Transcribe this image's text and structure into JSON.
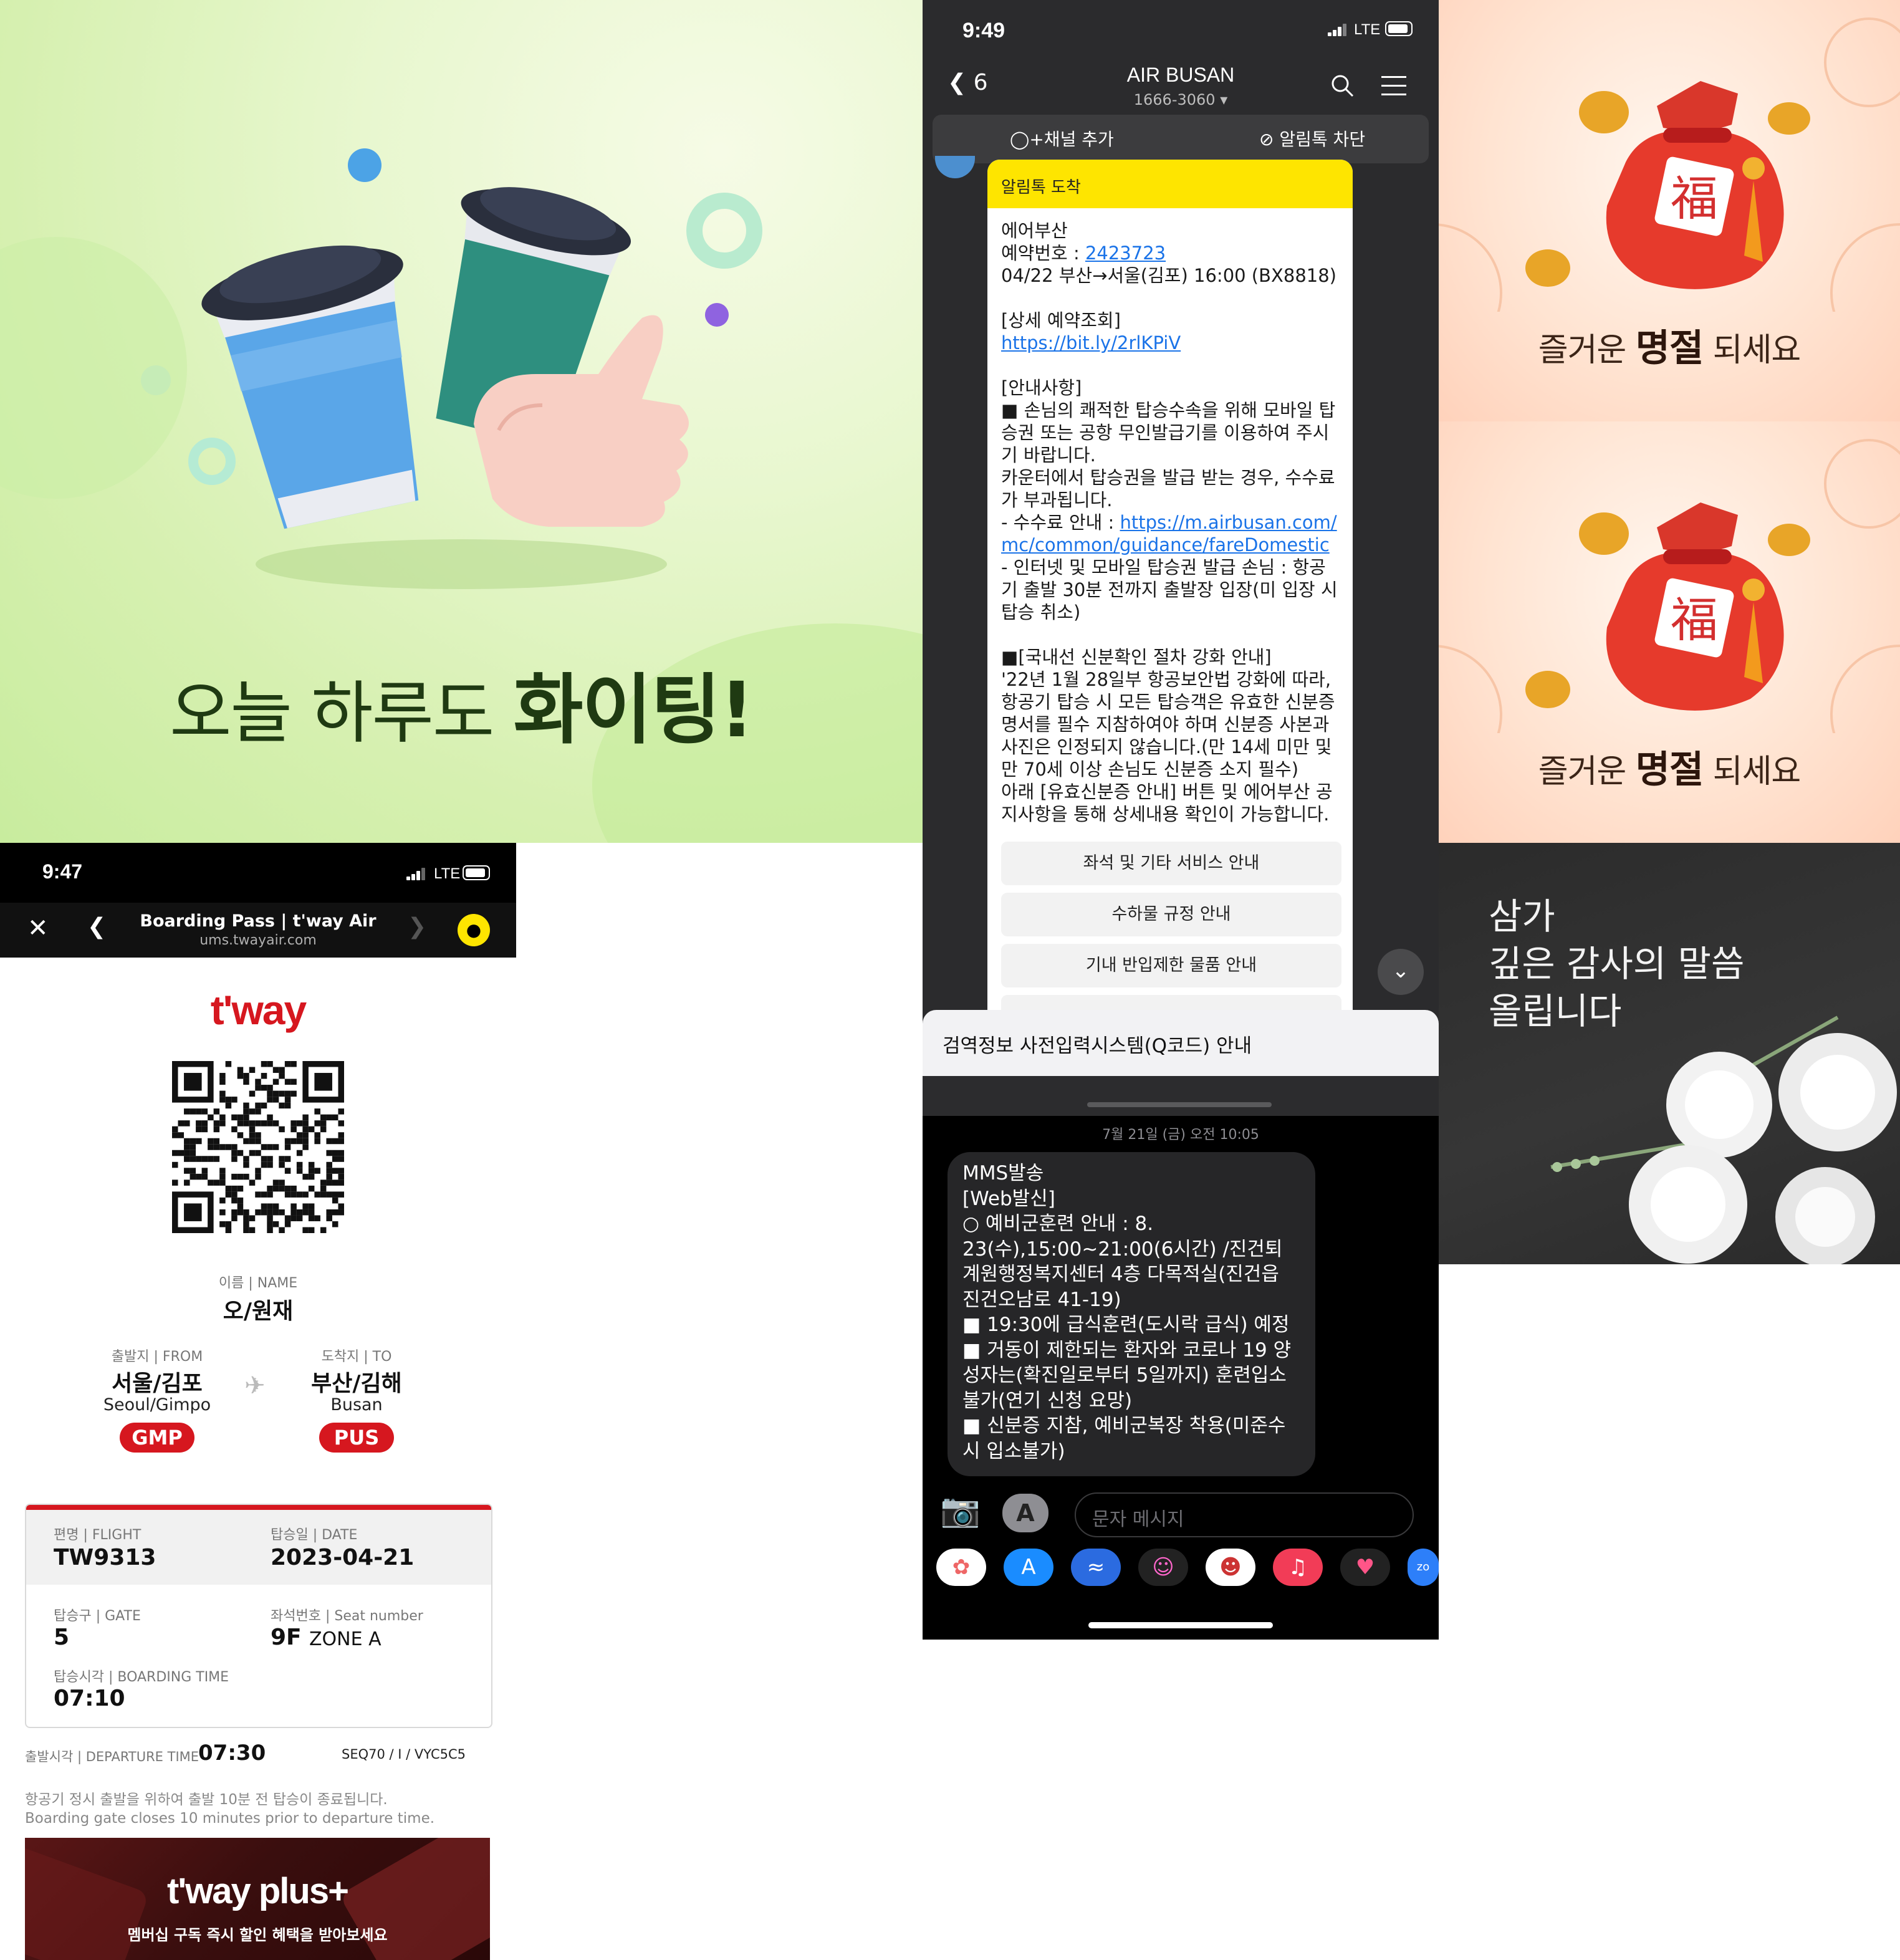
{
  "cheer": {
    "title_pre": "오늘 하루도 ",
    "title_bold": "화이팅!"
  },
  "chat": {
    "status_time": "9:49",
    "status_net": "LTE",
    "back_count": "6",
    "title": "AIR BUSAN",
    "phone": "1666-3060 ▾",
    "add_channel": "+채널 추가",
    "block": "알림톡 차단",
    "bubble_header": "알림톡 도착",
    "body_line1": "에어부산",
    "reservation_label": "예약번호 : ",
    "reservation_no": "2423723",
    "flight_line": "04/22 부산→서울(김포) 16:00 (BX8818)",
    "detail_heading": "[상세 예약조회]",
    "detail_link": "https://bit.ly/2rlKPiV",
    "notice_heading": "[안내사항]",
    "notice_1": "■ 손님의 쾌적한 탑승수속을 위해 모바일 탑승권 또는 공항 무인발급기를 이용하여 주시기 바랍니다.",
    "notice_2": "카운터에서 탑승권을 발급 받는 경우, 수수료가 부과됩니다.",
    "notice_3_label": "- 수수료 안내 : ",
    "notice_3_link": "https://m.airbusan.com/mc/common/guidance/fareDomestic",
    "notice_4": "- 인터넷 및 모바일 탑승권 발급 손님 : 항공기 출발 30분 전까지 출발장 입장(미 입장 시 탑승 취소)",
    "domestic_heading": "■[국내선 신분확인 절차 강화 안내]",
    "domestic_body": "'22년 1월 28일부 항공보안법 강화에 따라, 항공기 탑승 시 모든 탑승객은 유효한 신분증명서를 필수 지참하여야 하며 신분증 사본과 사진은 인정되지 않습니다.(만 14세 미만 및 만 70세 이상 손님도 신분증 소지 필수)",
    "domestic_body2": "아래 [유효신분증 안내] 버튼 및 에어부산 공지사항을 통해 상세내용 확인이 가능합니다.",
    "buttons": [
      "좌석 및 기타 서비스 안내",
      "수하물 규정 안내",
      "기내 반입제한 물품 안내"
    ],
    "sheet_item": "검역정보 사전입력시스템(Q코드) 안내"
  },
  "mms": {
    "date": "7월 21일 (금) 오전 10:05",
    "text": "MMS발송\n[Web발신]\n○ 예비군훈련 안내 : 8. 23(수),15:00~21:00(6시간) /진건퇴계원행정복지센터 4층 다목적실(진건읍 진건오남로 41-19)\n■ 19:30에 급식훈련(도시락 급식) 예정\n■ 거동이 제한되는 환자와 코로나 19 양성자는(확진일로부터 5일까지) 훈련입소불가(연기 신청 요망)\n■ 신분증 지참, 예비군복장 착용(미준수 시 입소불가)",
    "placeholder": "문자 메시지"
  },
  "holiday": {
    "pre": "즐거운 ",
    "bold": "명절",
    "post": " 되세요",
    "glyph": "福"
  },
  "condolence": {
    "text": "삼가\n깊은 감사의 말씀\n올립니다"
  },
  "tway": {
    "status_time": "9:47",
    "status_net": "LTE",
    "nav_title": "Boarding Pass | t'way Air",
    "nav_url": "ums.twayair.com",
    "logo": "t'way",
    "name_label": "이름 | NAME",
    "name": "오/원재",
    "from_label": "출발지 | FROM",
    "from_city": "서울/김포",
    "from_en": "Seoul/Gimpo",
    "from_code": "GMP",
    "to_label": "도착지 | TO",
    "to_city": "부산/김해",
    "to_en": "Busan",
    "to_code": "PUS",
    "flight_label": "편명 | FLIGHT",
    "flight": "TW9313",
    "date_label": "탑승일 | DATE",
    "date": "2023-04-21",
    "gate_label": "탑승구 | GATE",
    "gate": "5",
    "seat_label": "좌석번호 | Seat number",
    "seat": "9F",
    "zone": "ZONE A",
    "boarding_label": "탑승시각 | BOARDING TIME",
    "boarding": "07:10",
    "departure_label": "출발시각 | DEPARTURE TIME",
    "departure": "07:30",
    "seq": "SEQ70 / I / VYC5C5",
    "notice": "항공기 정시 출발을 위하여 출발 10분 전 탑승이 종료됩니다.\nBoarding gate closes 10 minutes prior to departure time.",
    "banner_logo": "t'way plus+",
    "banner_text": "멤버십 구독 즉시 할인 혜택을 받아보세요"
  },
  "colors": {
    "tway_red": "#d6171f",
    "kakao_yellow": "#fee500",
    "cheer_green": "#1f3a12"
  }
}
